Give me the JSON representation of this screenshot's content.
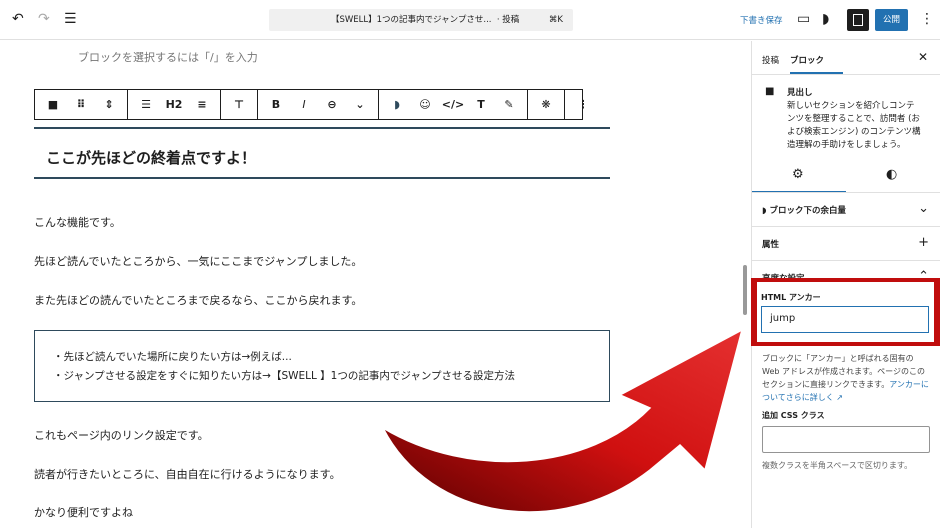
{
  "topbar": {
    "title": "【SWELL】1つの記事内でジャンプさせ...",
    "post_type": "· 投稿",
    "shortcut": "⌘K",
    "save_draft": "下書き保存",
    "publish": "公開"
  },
  "editor": {
    "placeholder": "ブロックを選択するには「/」を入力",
    "toolbar": {
      "heading_level": "H2",
      "bold": "B",
      "italic": "I"
    },
    "heading": "ここが先ほどの終着点ですよ！",
    "paragraphs1": [
      "こんな機能です。",
      "先ほど読んでいたところから、一気にここまでジャンプしました。",
      "また先ほどの読んでいたところまで戻るなら、ここから戻れます。"
    ],
    "box_items": [
      "・先ほど読んでいた場所に戻りたい方は→例えば...",
      "・ジャンプさせる設定をすぐに知りたい方は→【SWELL 】1つの記事内でジャンプさせる設定方法"
    ],
    "paragraphs2": [
      "これもページ内のリンク設定です。",
      "読者が行きたいところに、自由自在に行けるようになります。",
      "かなり便利ですよね"
    ]
  },
  "sidebar": {
    "tabs": [
      "投稿",
      "ブロック"
    ],
    "block_name": "見出し",
    "block_desc": "新しいセクションを紹介しコンテンツを整理することで、訪問者 (および検索エンジン) のコンテンツ構造理解の手助けをしましょう。",
    "panels": [
      "ブロック下の余白量",
      "属性",
      "高度な設定"
    ],
    "anchor_label": "HTML アンカー",
    "anchor_value": "jump",
    "anchor_help": "ブロックに「アンカー」と呼ばれる固有の Web アドレスが作成されます。ページのこのセクションに直接リンクできます。",
    "anchor_link": "アンカーについてさらに詳しく ↗",
    "css_label": "追加 CSS クラス",
    "css_help": "複数クラスを半角スペースで区切ります。"
  },
  "colors": {
    "accent": "#2271b1",
    "highlight": "#c00d0d",
    "heading_border": "#2e4a5c"
  }
}
